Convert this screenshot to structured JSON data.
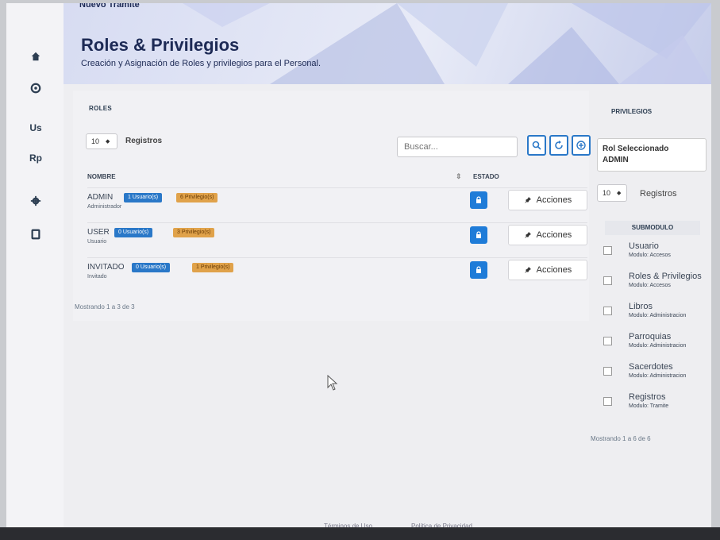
{
  "breadcrumb": "Nuevo Tramite",
  "header": {
    "title": "Roles & Privilegios",
    "subtitle": "Creación y Asignación de Roles y privilegios para el Personal."
  },
  "sidebar": {
    "items": [
      {
        "icon": "home-icon",
        "label": ""
      },
      {
        "icon": "circle-icon",
        "label": ""
      },
      {
        "icon": "",
        "label": "Us"
      },
      {
        "icon": "",
        "label": "Rp"
      },
      {
        "icon": "gear-icon",
        "label": ""
      },
      {
        "icon": "square-icon",
        "label": ""
      }
    ]
  },
  "roles": {
    "heading": "ROLES",
    "page_length": "10",
    "length_label": "Registros",
    "search_placeholder": "Buscar...",
    "columns": {
      "name": "NOMBRE",
      "status": "ESTADO"
    },
    "rows": [
      {
        "name": "ADMIN",
        "users": "1 Usuario(s)",
        "privileges": "6 Privilegio(s)",
        "desc": "Administrador",
        "action": "Acciones"
      },
      {
        "name": "USER",
        "users": "0 Usuario(s)",
        "privileges": "3 Privilegio(s)",
        "desc": "Usuario",
        "action": "Acciones"
      },
      {
        "name": "INVITADO",
        "users": "0 Usuario(s)",
        "privileges": "1 Privilegio(s)",
        "desc": "Invitado",
        "action": "Acciones"
      }
    ],
    "info": "Mostrando 1 a 3 de 3"
  },
  "privileges": {
    "heading": "PRIVILEGIOS",
    "selected_role_label": "Rol Seleccionado",
    "selected_role": "ADMIN",
    "page_length": "10",
    "length_label": "Registros",
    "column": "SUBMODULO",
    "rows": [
      {
        "name": "Usuario",
        "module": "Modulo: Accesos"
      },
      {
        "name": "Roles & Privilegios",
        "module": "Modulo: Accesos"
      },
      {
        "name": "Libros",
        "module": "Modulo: Administracion"
      },
      {
        "name": "Parroquias",
        "module": "Modulo: Administracion"
      },
      {
        "name": "Sacerdotes",
        "module": "Modulo: Administracion"
      },
      {
        "name": "Registros",
        "module": "Modulo: Tramite"
      }
    ],
    "info": "Mostrando 1 a 6 de 6"
  },
  "footer": {
    "terms": "Términos de Uso",
    "privacy": "Política de Privacidad"
  },
  "colors": {
    "primary": "#2a78c8",
    "warning": "#e0a24a",
    "title": "#1d2a55"
  }
}
